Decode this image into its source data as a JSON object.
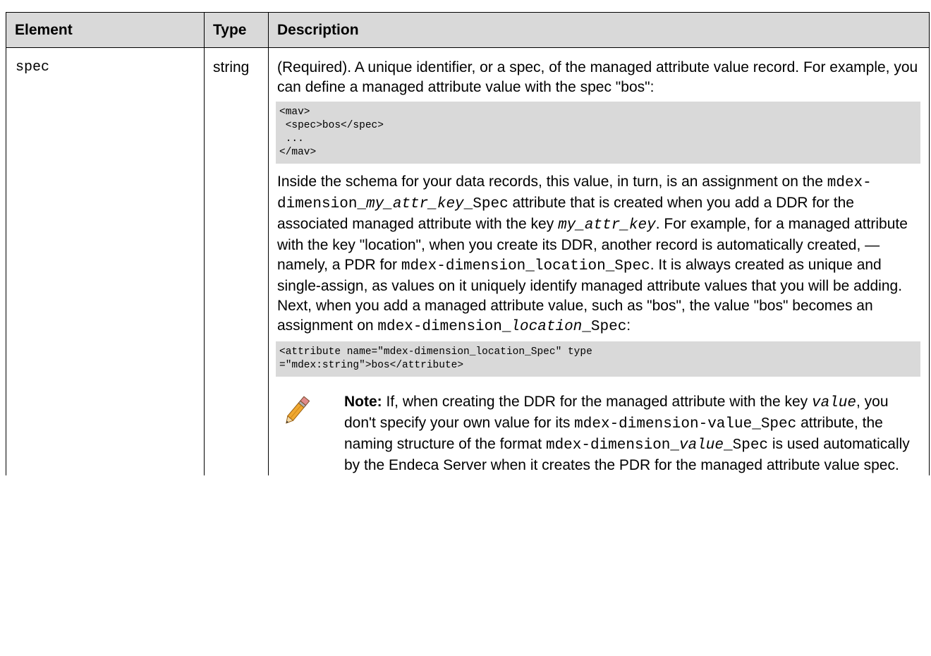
{
  "headers": {
    "element": "Element",
    "type": "Type",
    "description": "Description"
  },
  "row": {
    "element": "spec",
    "type": "string",
    "p1": "(Required). A unique identifier, or a spec, of the managed attribute value record. For example, you can define a managed attribute value with the spec \"bos\":",
    "code1": "<mav>\n <spec>bos</spec>\n ...\n</mav>",
    "p2": {
      "a": "Inside the schema for your data records, this value, in turn, is an assignment on the ",
      "b": "mdex-dimension_",
      "c": "my_attr_key",
      "d": "_Spec",
      "e": " attribute that is created when you add a DDR for the associated managed attribute with the key ",
      "f": "my_attr_key",
      "g": ". For example, for a managed attribute with the key \"location\", when you create its DDR, another record is automatically created, — namely, a PDR for ",
      "h": "mdex-dimension_location_Spec",
      "i": ". It is always created as unique and single-assign, as values on it uniquely identify managed attribute values that you will be adding. Next, when you add a managed attribute value, such as \"bos\", the value \"bos\" becomes an assignment on ",
      "j": "mdex-dimension_",
      "k": "location",
      "l": "_Spec",
      "m": ":"
    },
    "code2": "<attribute name=\"mdex-dimension_location_Spec\" type\n=\"mdex:string\">bos</attribute>",
    "note": {
      "icon": "pencil-icon",
      "label": "Note:",
      "a": " If, when creating the DDR for the managed attribute with the key ",
      "b": "value",
      "c": ", you don't specify your own value for its ",
      "d": "mdex-dimension-value_Spec",
      "e": " attribute, the naming structure of the format ",
      "f": "mdex-dimension_",
      "g": "value",
      "h": "_Spec",
      "i": " is used automatically by the Endeca Server when it creates the PDR for the managed attribute value spec."
    }
  }
}
